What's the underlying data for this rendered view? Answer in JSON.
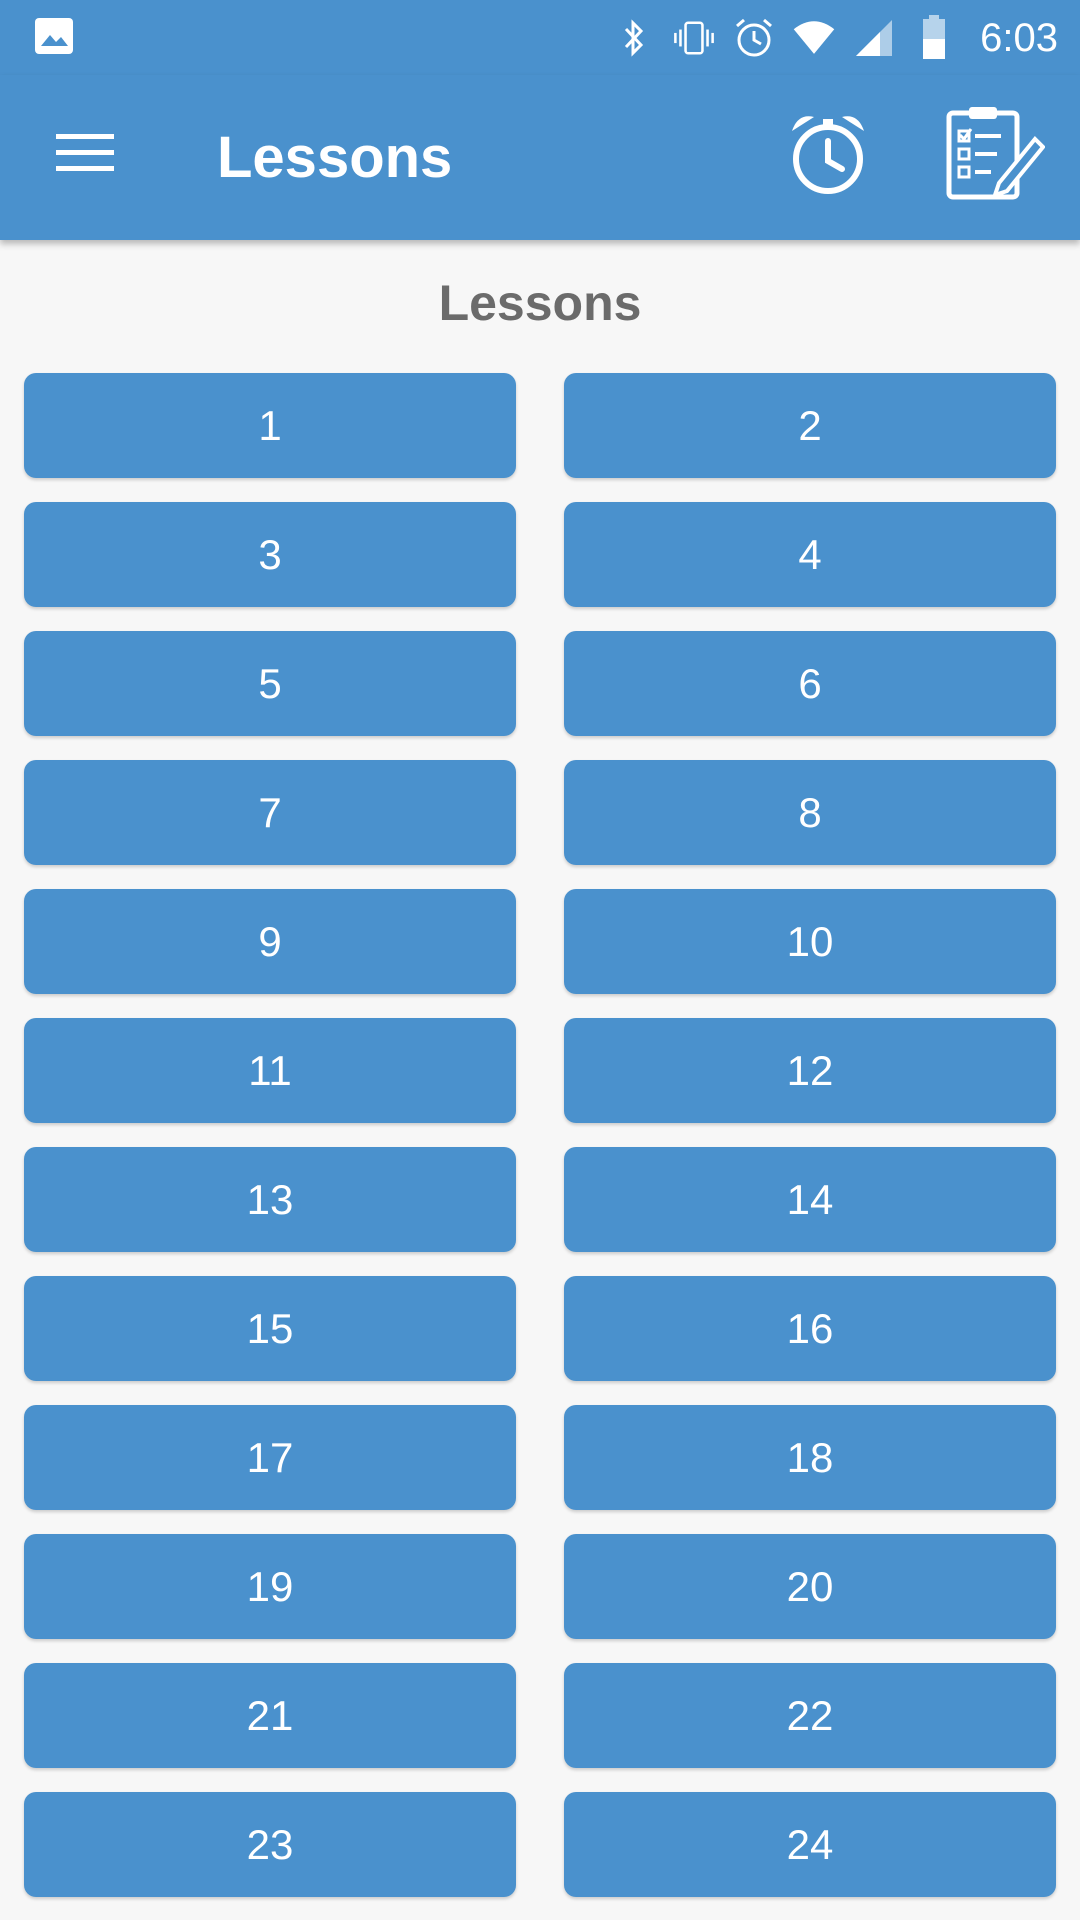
{
  "status_bar": {
    "time": "6:03",
    "icons": [
      "image-icon",
      "bluetooth-icon",
      "vibrate-icon",
      "alarm-status-icon",
      "wifi-icon",
      "signal-icon",
      "battery-icon"
    ]
  },
  "app_bar": {
    "title": "Lessons",
    "menu_icon": "menu-icon",
    "alarm_icon": "alarm-clock-icon",
    "notes_icon": "clipboard-edit-icon"
  },
  "main": {
    "heading": "Lessons",
    "lessons": [
      "1",
      "2",
      "3",
      "4",
      "5",
      "6",
      "7",
      "8",
      "9",
      "10",
      "11",
      "12",
      "13",
      "14",
      "15",
      "16",
      "17",
      "18",
      "19",
      "20",
      "21",
      "22",
      "23",
      "24"
    ]
  },
  "colors": {
    "primary": "#4a91cd",
    "background": "#f7f7f7",
    "heading_text": "#6b6b6b",
    "button_text": "#ffffff"
  }
}
